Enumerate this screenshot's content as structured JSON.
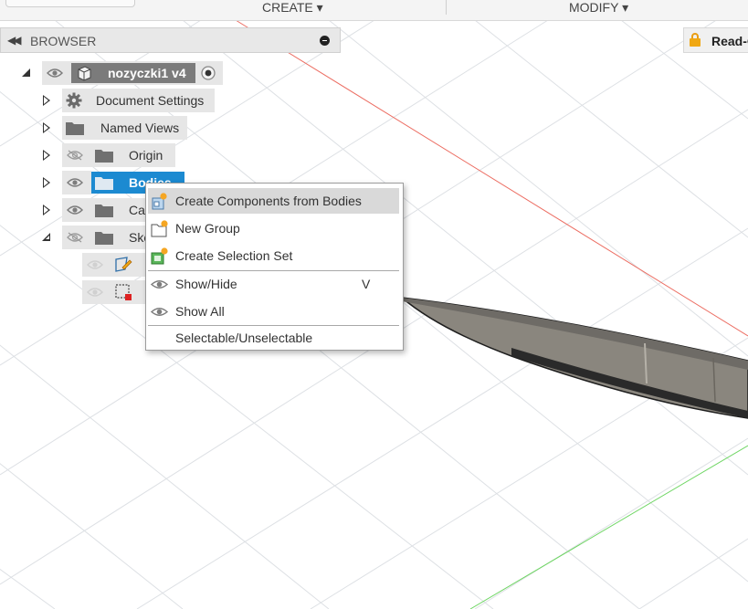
{
  "toolbar": {
    "menus": [
      {
        "label": "CREATE ▾"
      },
      {
        "label": "MODIFY ▾"
      }
    ]
  },
  "browser": {
    "title": "BROWSER",
    "root": {
      "label": "nozyczki1 v4"
    },
    "items": [
      {
        "label": "Document Settings"
      },
      {
        "label": "Named Views"
      },
      {
        "label": "Origin"
      },
      {
        "label": "Bodies"
      },
      {
        "label": "Ca"
      },
      {
        "label": "Ske"
      }
    ]
  },
  "readonly": {
    "label": "Read-O"
  },
  "context_menu": {
    "items": [
      {
        "label": "Create Components from Bodies",
        "icon": "create-components-icon"
      },
      {
        "label": "New Group",
        "icon": "new-group-icon"
      },
      {
        "label": "Create Selection Set",
        "icon": "selection-set-icon"
      },
      {
        "label": "Show/Hide",
        "icon": "eye-icon",
        "shortcut": "V"
      },
      {
        "label": "Show All",
        "icon": "eye-icon"
      },
      {
        "label": "Selectable/Unselectable"
      }
    ]
  },
  "colors": {
    "selection": "#1c8ad1",
    "x_axis": "#e8665a",
    "z_axis": "#6ad25f",
    "grid": "#d9dce0",
    "body_fill": "#8f8a80"
  }
}
